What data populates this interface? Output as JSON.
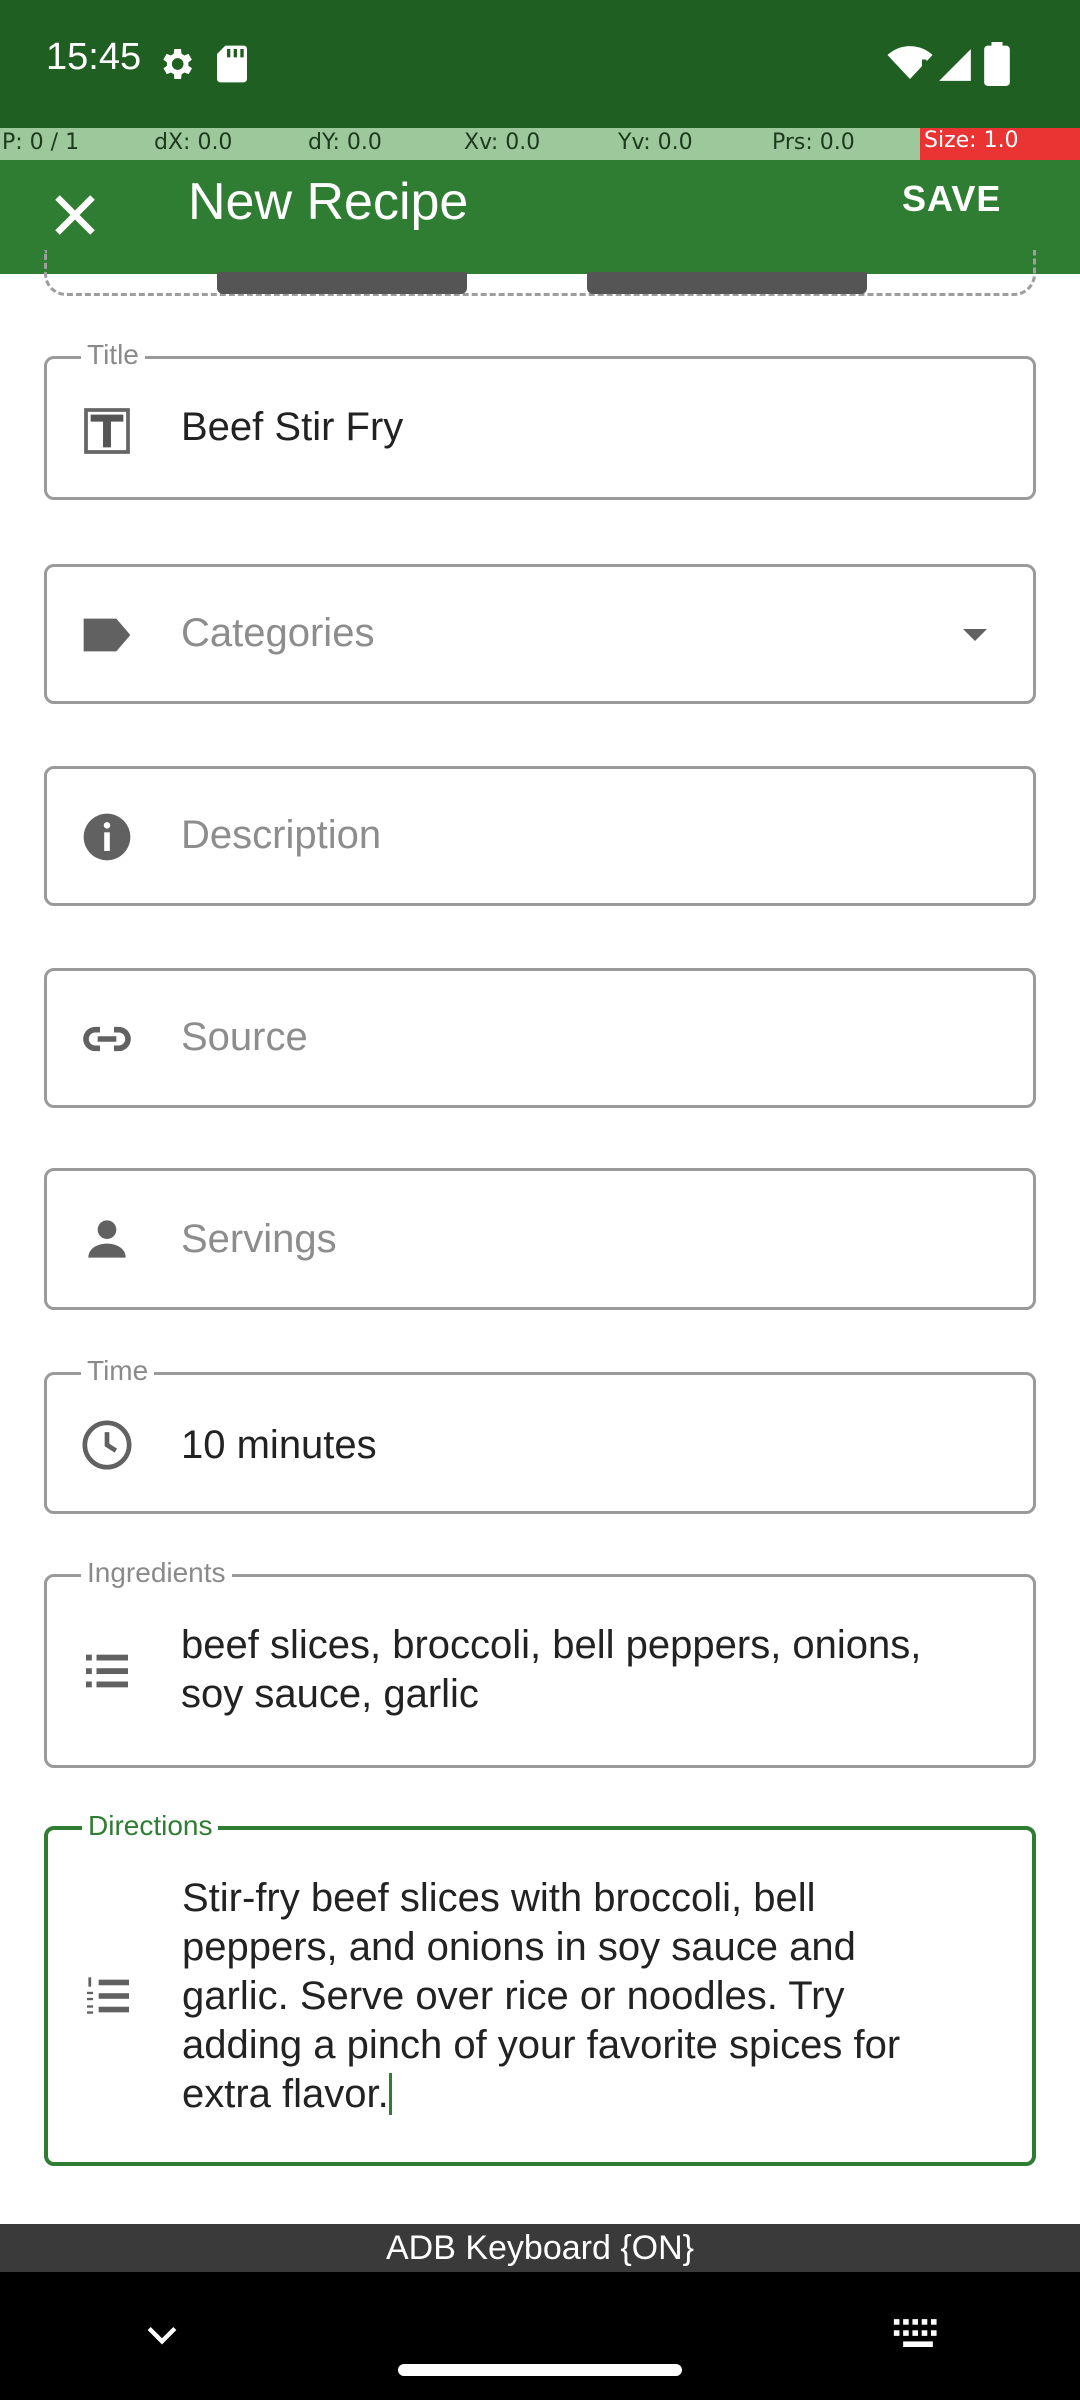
{
  "status_bar": {
    "time": "15:45",
    "icons": [
      "gear-icon",
      "sd-card-icon",
      "wifi-icon",
      "signal-icon",
      "battery-icon"
    ]
  },
  "pointer_bar": {
    "p": "P: 0 / 1",
    "dx": "dX: 0.0",
    "dy": "dY: 0.0",
    "xv": "Xv: 0.0",
    "yv": "Yv: 0.0",
    "prs": "Prs: 0.0",
    "size": "Size: 1.0"
  },
  "app_bar": {
    "title": "New Recipe",
    "save_label": "SAVE",
    "close_icon": "close-icon"
  },
  "form": {
    "title": {
      "label": "Title",
      "value": "Beef Stir Fry",
      "icon": "title-icon"
    },
    "categories": {
      "placeholder": "Categories",
      "icon": "label-icon"
    },
    "description": {
      "placeholder": "Description",
      "icon": "info-icon"
    },
    "source": {
      "placeholder": "Source",
      "icon": "link-icon"
    },
    "servings": {
      "placeholder": "Servings",
      "icon": "person-icon"
    },
    "time": {
      "label": "Time",
      "value": "10 minutes",
      "icon": "clock-icon"
    },
    "ingredients": {
      "label": "Ingredients",
      "line1": "beef slices, broccoli, bell peppers, onions,",
      "line2": "soy sauce, garlic",
      "icon": "list-icon"
    },
    "directions": {
      "label": "Directions",
      "line1": "Stir-fry beef slices with broccoli, bell",
      "line2": "peppers, and onions in soy sauce and",
      "line3": "garlic. Serve over rice or noodles. Try",
      "line4": "adding a pinch of your favorite spices for",
      "line5": "extra flavor.",
      "icon": "numbered-list-icon"
    }
  },
  "keyboard_indicator": "ADB Keyboard {ON}",
  "colors": {
    "status_bar": "#1f5f21",
    "app_bar": "#2f7d32",
    "accent": "#2f7d32"
  }
}
